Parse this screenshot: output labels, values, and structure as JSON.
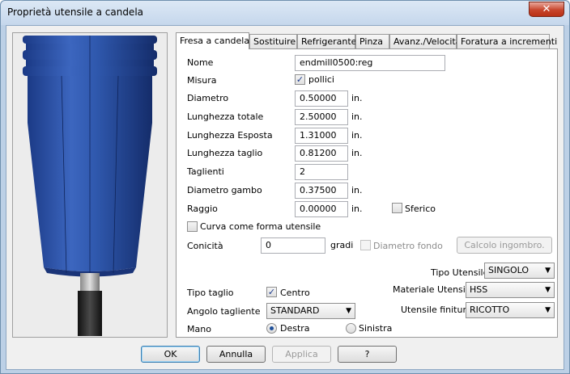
{
  "window": {
    "title": "Proprietà utensile a candela",
    "close_label": "✕"
  },
  "tabs": [
    {
      "label": "Fresa a candela",
      "active": true
    },
    {
      "label": "Sostituire"
    },
    {
      "label": "Refrigerante"
    },
    {
      "label": "Pinza"
    },
    {
      "label": "Avanz./Velocità"
    },
    {
      "label": "Foratura a incrementi"
    }
  ],
  "fields": {
    "nome": {
      "label": "Nome",
      "value": "endmill0500:reg"
    },
    "misura": {
      "label": "Misura",
      "checkbox_label": "pollici",
      "checked": true
    },
    "diametro": {
      "label": "Diametro",
      "value": "0.50000",
      "unit": "in."
    },
    "lunghezza_totale": {
      "label": "Lunghezza totale",
      "value": "2.50000",
      "unit": "in."
    },
    "lunghezza_esposta": {
      "label": "Lunghezza Esposta",
      "value": "1.31000",
      "unit": "in."
    },
    "lunghezza_taglio": {
      "label": "Lunghezza taglio",
      "value": "0.81200",
      "unit": "in."
    },
    "taglienti": {
      "label": "Taglienti",
      "value": "2"
    },
    "diametro_gambo": {
      "label": "Diametro gambo",
      "value": "0.37500",
      "unit": "in."
    },
    "raggio": {
      "label": "Raggio",
      "value": "0.00000",
      "unit": "in."
    },
    "sferico": {
      "label": "Sferico",
      "checked": false
    },
    "curva": {
      "label": "Curva come forma utensile",
      "checked": false
    },
    "conicita": {
      "label": "Conicità",
      "value": "0",
      "unit": "gradi"
    },
    "diametro_fondo": {
      "label": "Diametro fondo",
      "checked": false,
      "disabled": true
    },
    "calcolo_button": "Calcolo ingombro.",
    "tipo_utensile": {
      "label": "Tipo Utensile",
      "value": "SINGOLO"
    },
    "tipo_taglio": {
      "label": "Tipo taglio",
      "checkbox_label": "Centro",
      "checked": true
    },
    "materiale": {
      "label": "Materiale Utensile",
      "value": "HSS"
    },
    "angolo": {
      "label": "Angolo tagliente",
      "value": "STANDARD"
    },
    "finitura": {
      "label": "Utensile finitura",
      "value": "RICOTTO"
    },
    "mano": {
      "label": "Mano",
      "option_right": "Destra",
      "option_left": "Sinistra",
      "selected": "Destra"
    }
  },
  "buttons": {
    "ok": "OK",
    "annulla": "Annulla",
    "applica": "Applica",
    "help": "?"
  },
  "colors": {
    "tool_body": "#2d55a8",
    "tool_shank": "#303030",
    "shaft": "#c8c8c8"
  }
}
